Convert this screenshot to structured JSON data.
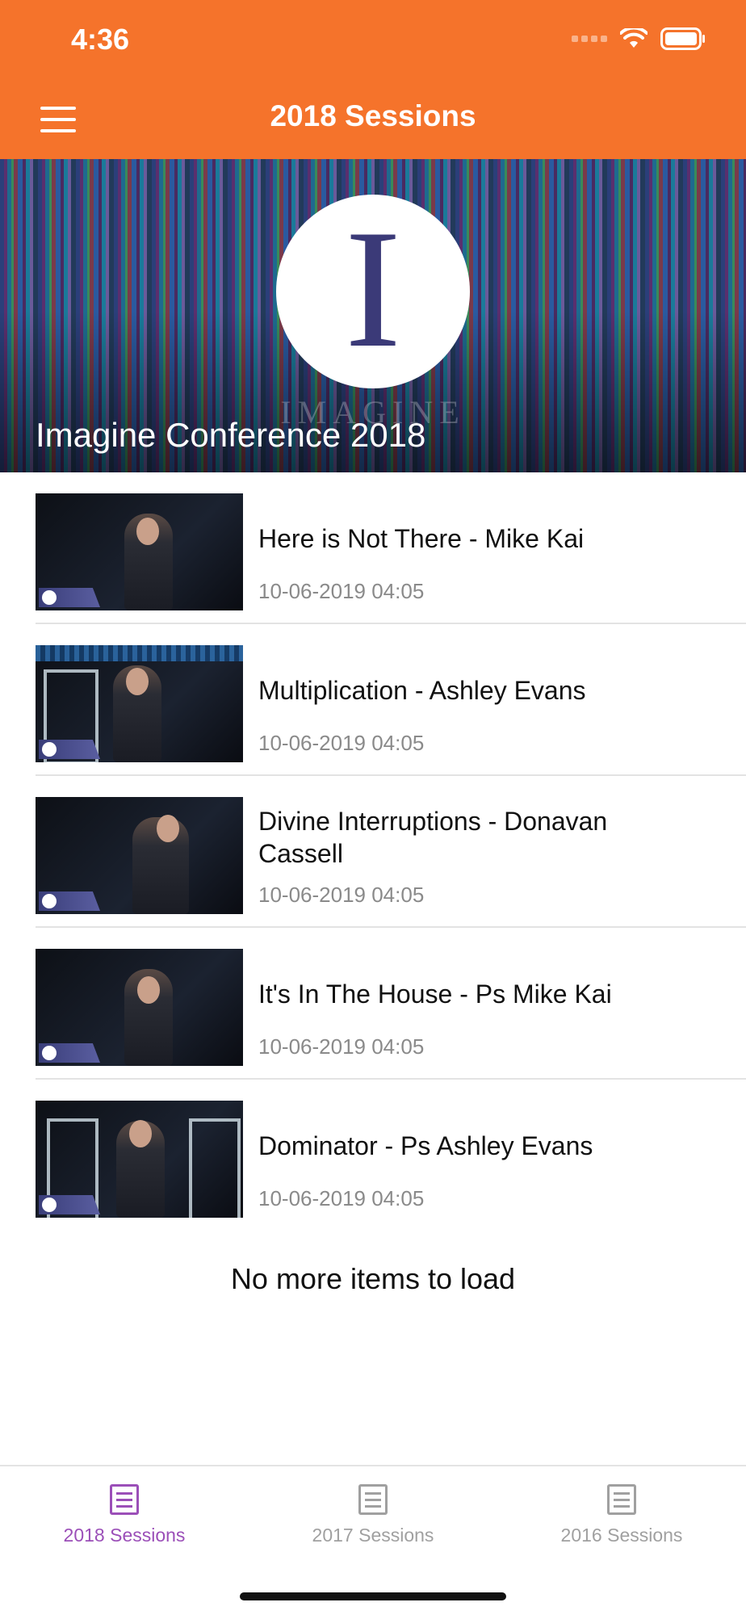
{
  "status_bar": {
    "time": "4:36"
  },
  "header": {
    "title": "2018 Sessions",
    "menu_icon": "hamburger-menu-icon"
  },
  "hero": {
    "title": "Imagine Conference 2018",
    "logo_letter": "I",
    "logo_word": "IMAGINE"
  },
  "sessions": [
    {
      "title": "Here is Not There - Mike Kai",
      "date": "10-06-2019 04:05"
    },
    {
      "title": "Multiplication - Ashley Evans",
      "date": "10-06-2019 04:05"
    },
    {
      "title": "Divine Interruptions - Donavan Cassell",
      "date": "10-06-2019 04:05"
    },
    {
      "title": "It's In The House - Ps Mike Kai",
      "date": "10-06-2019 04:05"
    },
    {
      "title": "Dominator - Ps Ashley Evans",
      "date": "10-06-2019 04:05"
    }
  ],
  "list_footer": "No more items to load",
  "tabs": [
    {
      "label": "2018 Sessions",
      "active": true
    },
    {
      "label": "2017 Sessions",
      "active": false
    },
    {
      "label": "2016 Sessions",
      "active": false
    }
  ],
  "colors": {
    "header": "#f5732b",
    "tab_active": "#9b4fb8",
    "tab_inactive": "#a0a0a0"
  }
}
